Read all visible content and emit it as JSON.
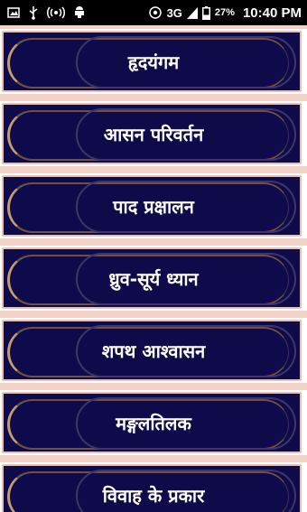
{
  "status_bar": {
    "network": "3G",
    "battery": "27%",
    "time": "10:40 PM",
    "icons": [
      "image-icon",
      "usb-icon",
      "hotspot-icon",
      "android-debug-icon",
      "wifi-calling-icon",
      "signal-icon",
      "battery-icon"
    ]
  },
  "menu": {
    "items": [
      {
        "label": "हृदयंगम"
      },
      {
        "label": "आसन परिवर्तन"
      },
      {
        "label": "पाद प्रक्षालन"
      },
      {
        "label": "ध्रुव-सूर्य ध्यान"
      },
      {
        "label": "शपथ आश्वासन"
      },
      {
        "label": "मङ्गलतिलक"
      },
      {
        "label": "विवाह के प्रकार"
      }
    ]
  },
  "colors": {
    "card_bg": "#0f0a4a",
    "card_border": "#e7c0b0",
    "list_bg": "#f3d2c7",
    "label_text": "#ffffff"
  }
}
